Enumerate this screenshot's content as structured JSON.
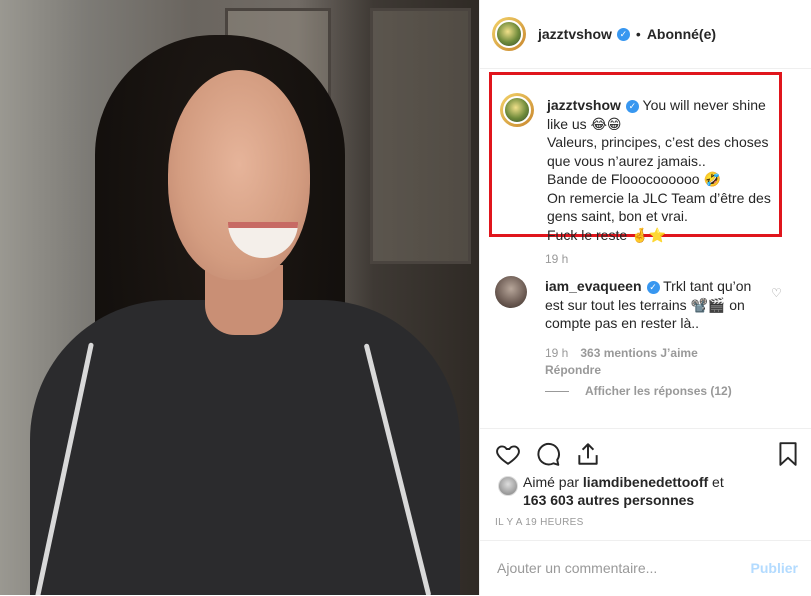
{
  "post_header": {
    "username": "jazztvshow",
    "follow_status": "Abonné(e)"
  },
  "caption": {
    "username": "jazztvshow",
    "lines": [
      "You will never shine like us 😂😁",
      "Valeurs, principes, c’est des choses que vous n’aurez jamais..",
      "Bande de Flooocoooooo 🤣",
      "On remercie la JLC Team d’être des gens saint, bon et vrai.",
      "Fuck le reste 🤞⭐"
    ],
    "time": "19 h"
  },
  "comment": {
    "username": "iam_evaqueen",
    "text": "Trkl tant qu’on est sur tout les terrains 📽️🎬 on compte pas en rester là..",
    "time": "19 h",
    "likes": "363 mentions J’aime",
    "reply": "Répondre",
    "view_replies": "Afficher les réponses (12)"
  },
  "likes": {
    "prefix": "Aimé par",
    "user": "liamdibenedettooff",
    "conjunction": "et",
    "others": "163 603 autres personnes"
  },
  "timestamp": "IL Y A 19 HEURES",
  "composer": {
    "placeholder": "Ajouter un commentaire...",
    "publish": "Publier"
  },
  "colors": {
    "verified": "#3897f0",
    "highlight_border": "#e0151c",
    "publish_disabled": "#b3dbff"
  },
  "icons": [
    "heart-icon",
    "comment-icon",
    "share-icon",
    "bookmark-icon",
    "verified-badge-icon"
  ]
}
